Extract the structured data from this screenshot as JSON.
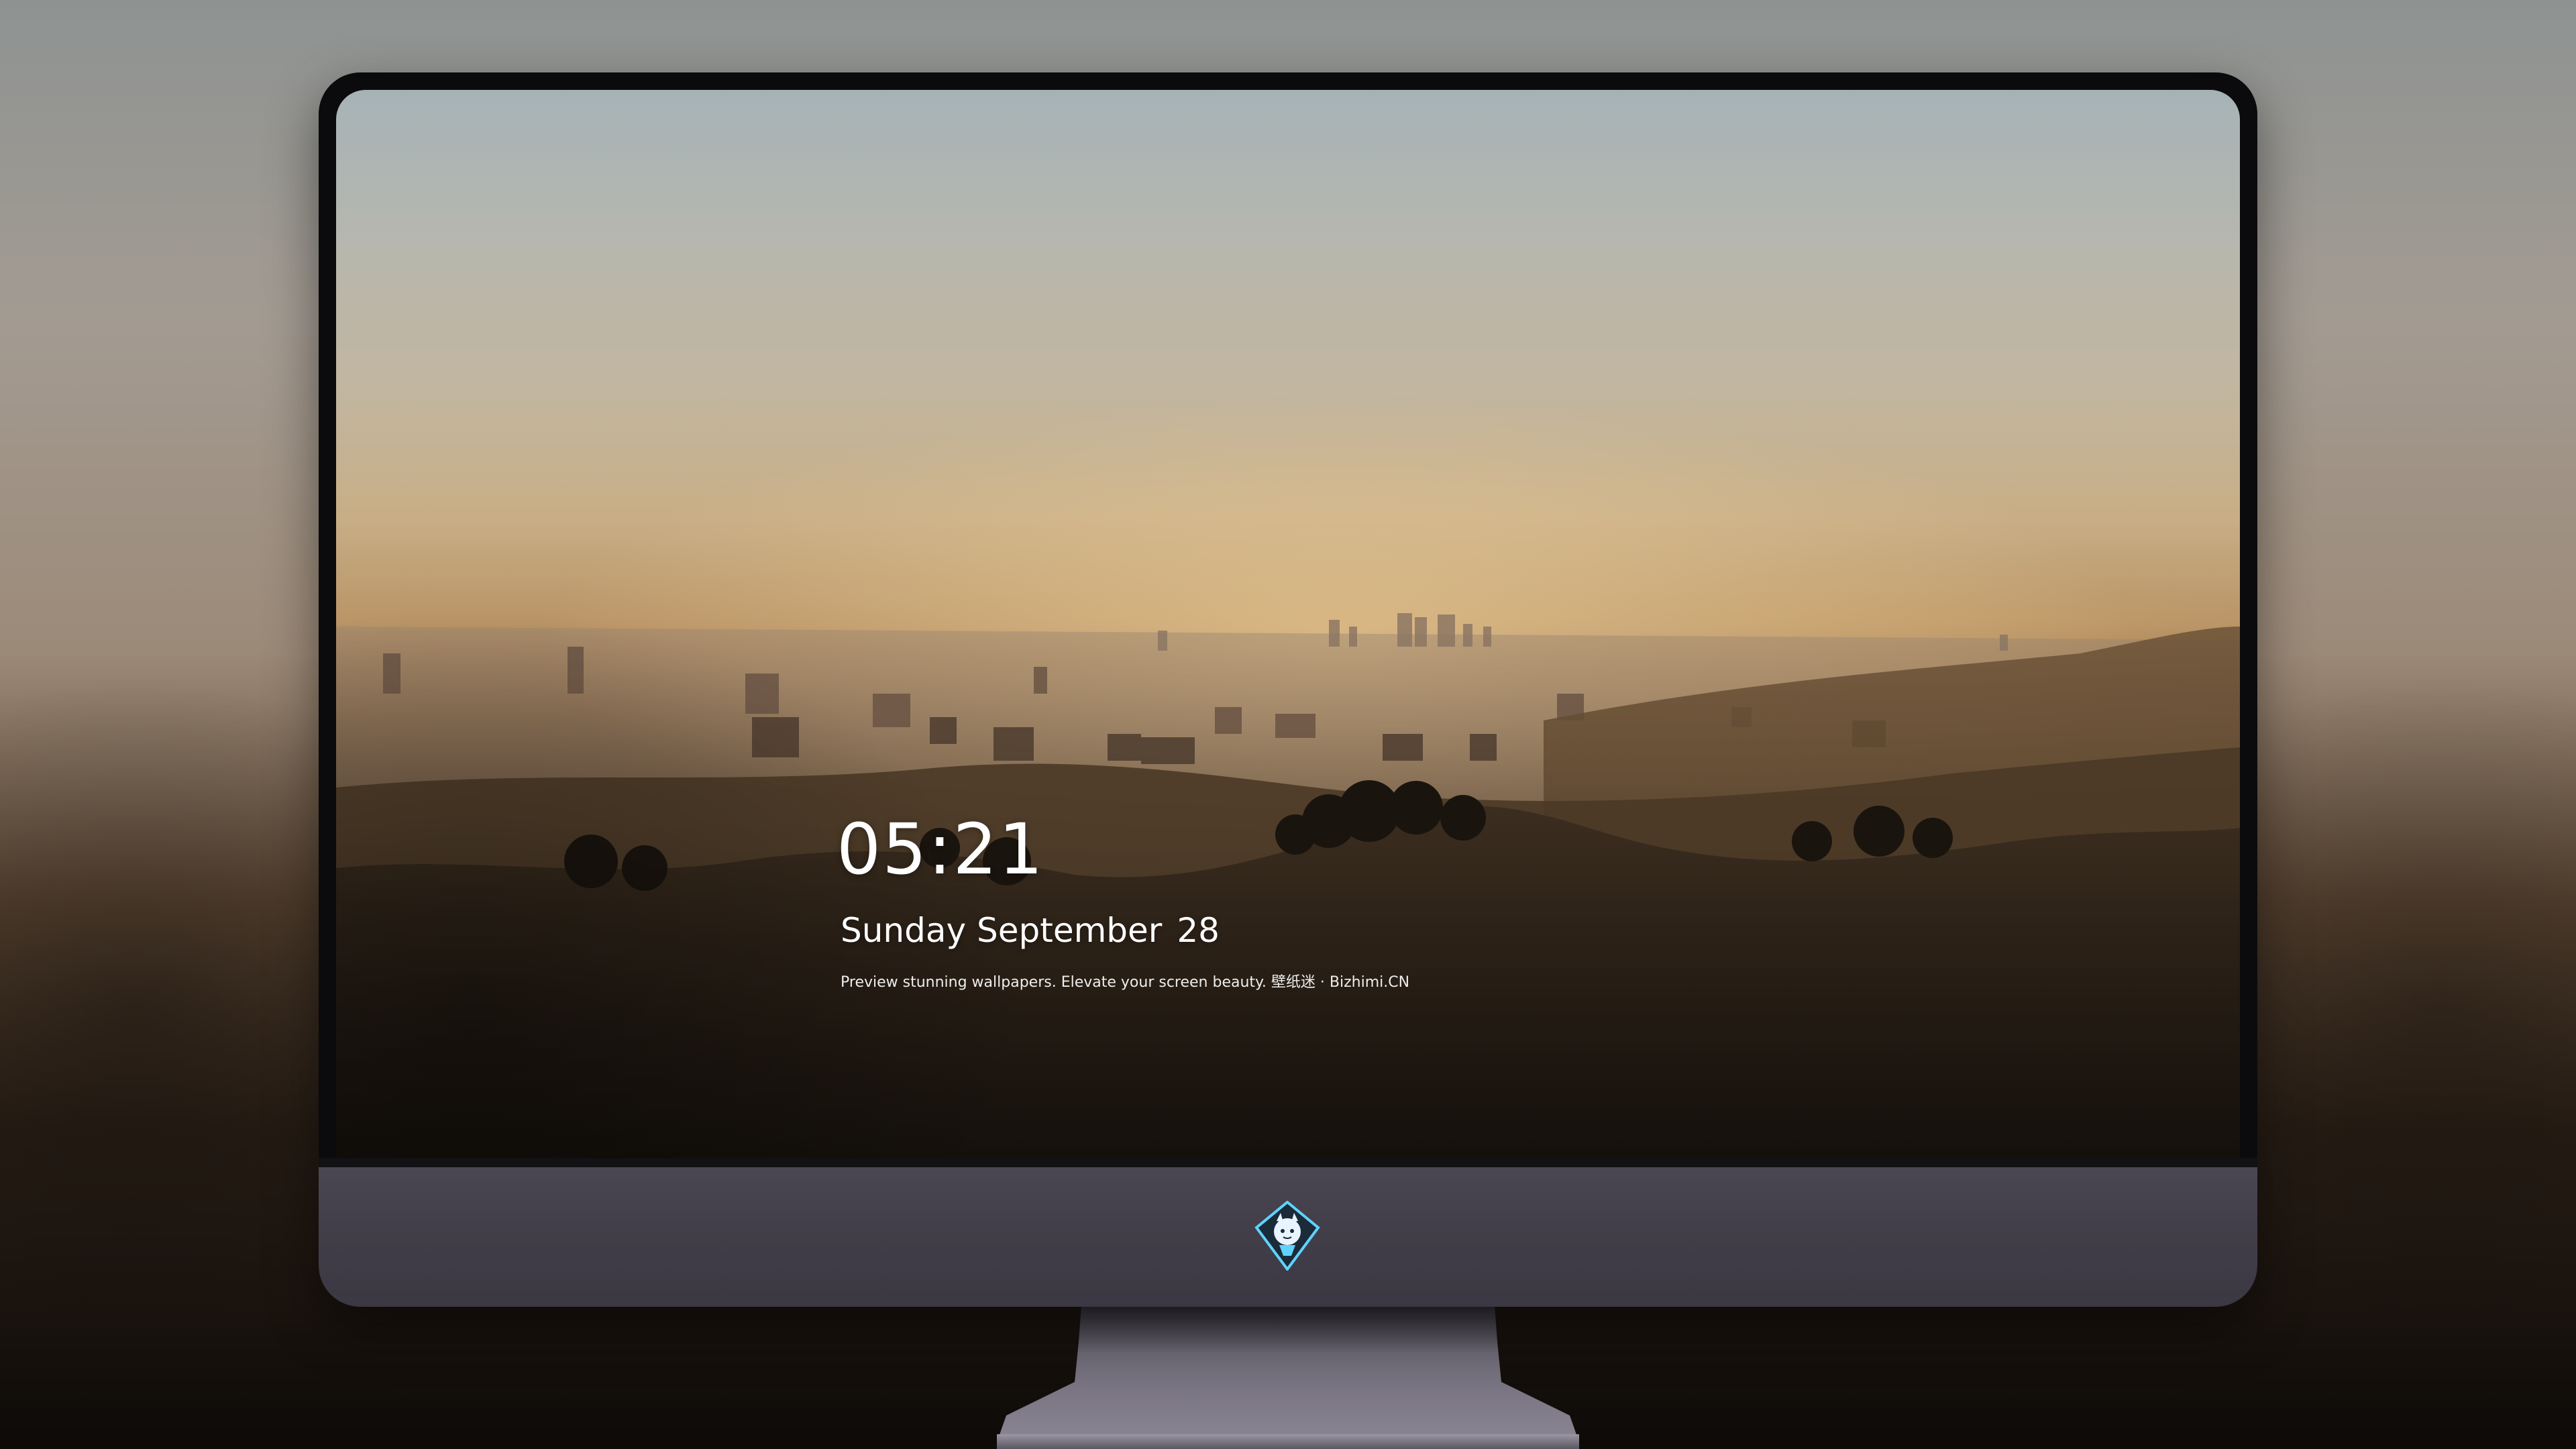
{
  "lockscreen": {
    "time": "05:21",
    "weekday_month": "Sunday September",
    "day": "28",
    "tagline": "Preview stunning wallpapers. Elevate your screen beauty. 壁纸迷 · Bizhimi.CN"
  },
  "dock": {
    "items": [
      {
        "name": "messages-icon",
        "color": "#34c759"
      },
      {
        "name": "weather-icon",
        "color": "#2f8ff0"
      },
      {
        "name": "clock-icon",
        "color": "#111111"
      },
      {
        "name": "preview-icon",
        "color": "#f4c84b"
      },
      {
        "name": "clips-icon",
        "color": "#58c8f0"
      },
      {
        "name": "notes-icon",
        "color": "#ffd54a"
      },
      {
        "name": "photo-grid-icon",
        "color": "#f0f0f0"
      },
      {
        "name": "music-icon",
        "color": "#e14dd6"
      },
      {
        "name": "app-store-icon",
        "color": "#1e7cf2"
      },
      {
        "name": "camera-icon",
        "color": "#8a8a8e"
      }
    ]
  },
  "monitor": {
    "logo": "chin-logo-icon"
  }
}
